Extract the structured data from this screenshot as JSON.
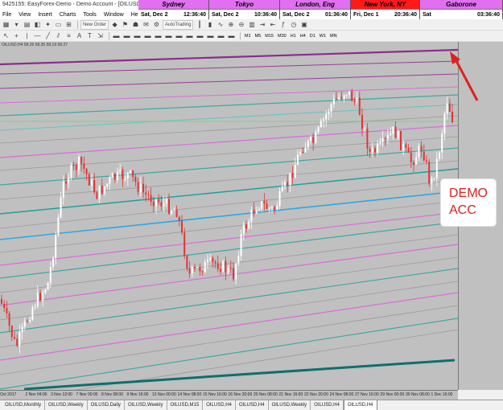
{
  "window": {
    "title": "9425155: EasyForex-Demo - Demo Account - [OILUSD,H4]"
  },
  "clocks": [
    {
      "city": "Sydney",
      "date": "Sat, Dec 2",
      "time": "12:36:40",
      "color": "#e070f0",
      "w": 88
    },
    {
      "city": "Tokyo",
      "date": "Sat, Dec 2",
      "time": "10:36:40",
      "color": "#e070f0",
      "w": 88
    },
    {
      "city": "London, Eng",
      "date": "Sat, Dec 2",
      "time": "01:36:40",
      "color": "#e070f0",
      "w": 88
    },
    {
      "city": "New York, NY",
      "date": "Fri, Dec 1",
      "time": "20:36:40",
      "color": "#ff1a1a",
      "w": 86
    },
    {
      "city": "Gaborone",
      "date": "Sat",
      "time": "03:36:40",
      "color": "#e070f0",
      "w": 103
    }
  ],
  "menu": [
    "File",
    "View",
    "Insert",
    "Charts",
    "Tools",
    "Window",
    "Help"
  ],
  "toolbar": {
    "new_order": "New Order",
    "autotrading": "AutoTrading",
    "timeframes": [
      "M1",
      "M5",
      "M15",
      "M30",
      "H1",
      "H4",
      "D1",
      "W1",
      "MN"
    ]
  },
  "chart": {
    "info": "OILUSD,H4  58.26 58.35 58.19 58.27",
    "demo_label_1": "DEMO",
    "demo_label_2": "ACC",
    "dates": [
      "Oct 2017",
      "2 Nov 04:00",
      "3 Nov 12:00",
      "7 Nov 00:00",
      "8 Nov 08:00",
      "9 Nov 16:00",
      "13 Nov 00:00",
      "14 Nov 08:00",
      "15 Nov 16:00",
      "16 Nov 20:00",
      "20 Nov 08:00",
      "21 Nov 16:00",
      "22 Nov 20:00",
      "24 Nov 08:00",
      "27 Nov 16:00",
      "29 Nov 00:00",
      "30 Nov 08:00",
      "1 Dec 16:00"
    ]
  },
  "tabs": [
    "OILUSD,Monthly",
    "OILUSD,Weekly",
    "OILUSD,Daily",
    "OILUSD,Weekly",
    "OILUSD,M15",
    "OILUSD,H4",
    "OILUSD,H4",
    "OILUSD,Weekly",
    "OILUSD,H4",
    "OILUSD,H4"
  ],
  "active_tab_index": 9,
  "colors": {
    "chart_bg": "#c0c0c0",
    "bull": "#ffffff",
    "bear": "#e23434",
    "arrow": "#e02020"
  }
}
